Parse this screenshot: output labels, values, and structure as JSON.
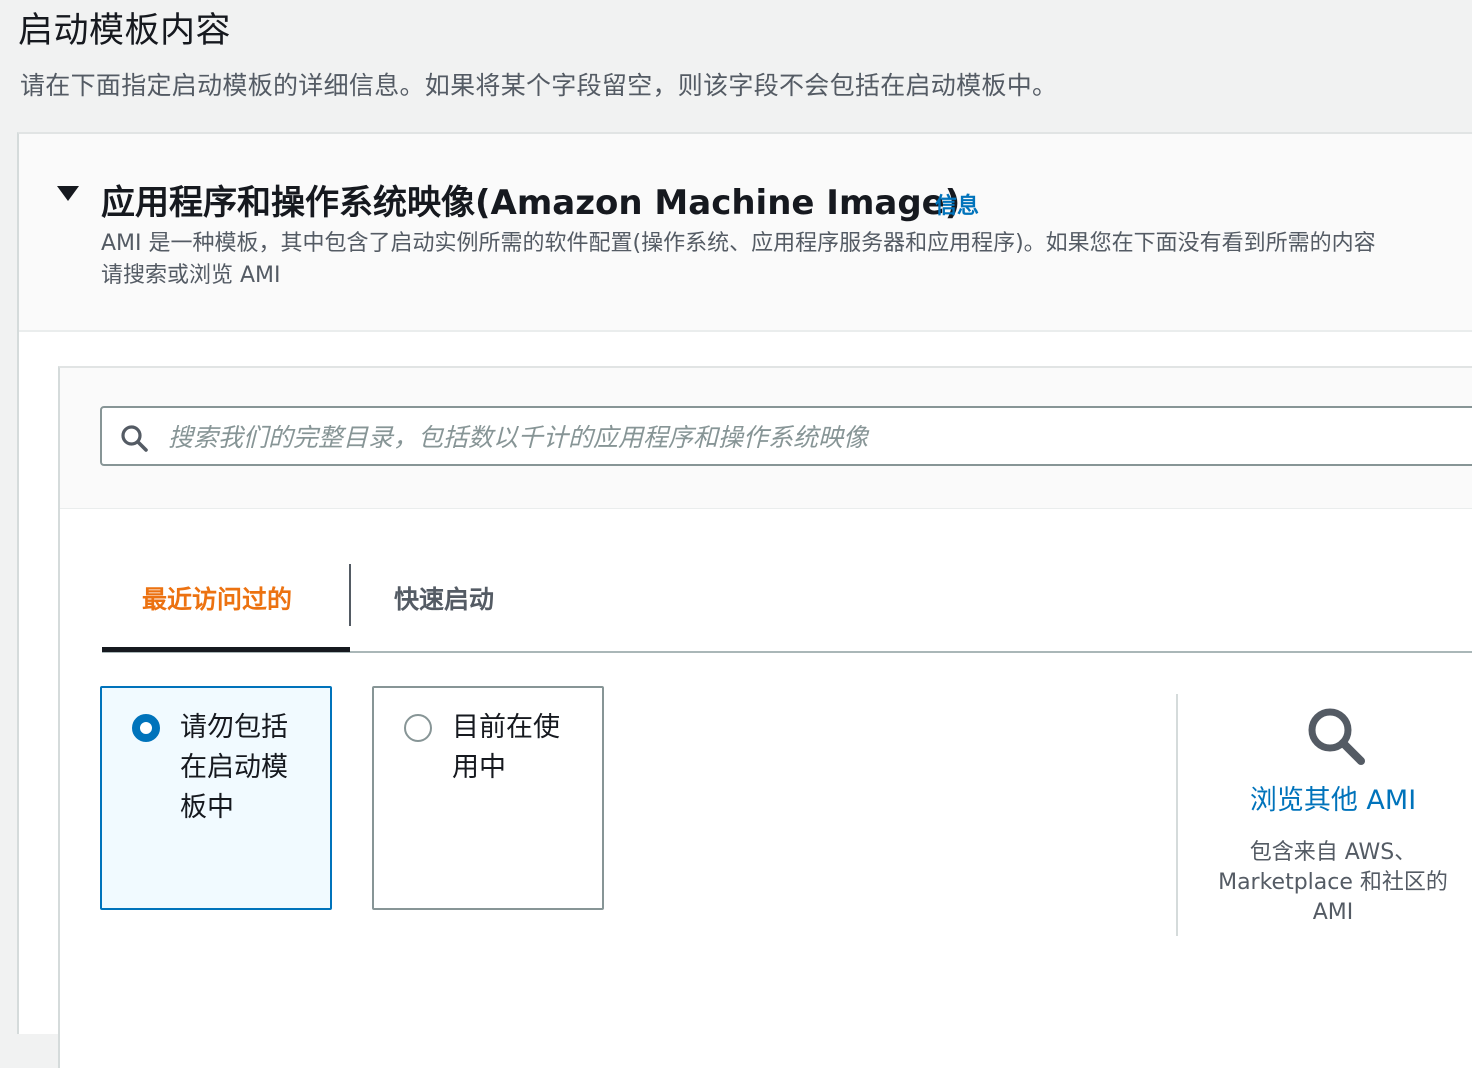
{
  "page": {
    "title": "启动模板内容",
    "description": "请在下面指定启动模板的详细信息。如果将某个字段留空，则该字段不会包括在启动模板中。"
  },
  "ami_section": {
    "title": "应用程序和操作系统映像(Amazon Machine Image)",
    "info_link": "信息",
    "description_line1": "AMI 是一种模板，其中包含了启动实例所需的软件配置(操作系统、应用程序服务器和应用程序)。如果您在下面没有看到所需的内容",
    "description_line2": "请搜索或浏览 AMI",
    "search": {
      "placeholder": "搜索我们的完整目录，包括数以千计的应用程序和操作系统映像",
      "value": ""
    },
    "tabs": [
      {
        "label": "最近访问过的",
        "active": true
      },
      {
        "label": "快速启动",
        "active": false
      }
    ],
    "options": [
      {
        "label": "请勿包括在启动模板中",
        "selected": true
      },
      {
        "label": "目前在使用中",
        "selected": false
      }
    ],
    "browse": {
      "link": "浏览其他 AMI",
      "description": "包含来自 AWS、Marketplace 和社区的 AMI"
    }
  },
  "colors": {
    "accent_blue": "#0073bb",
    "active_tab_orange": "#ec7211",
    "text_primary": "#16191f",
    "text_secondary": "#545b64"
  }
}
